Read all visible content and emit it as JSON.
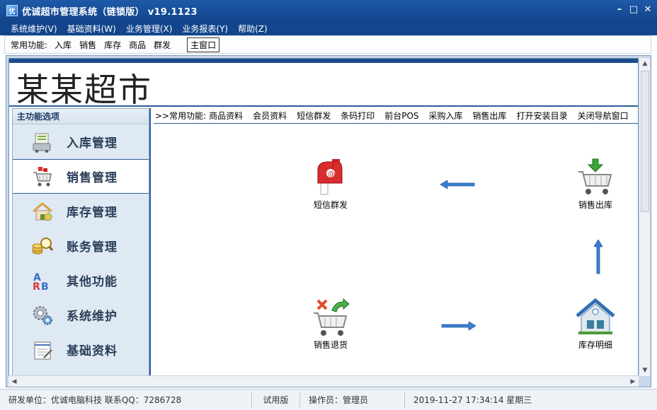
{
  "window": {
    "title": "优诚超市管理系统（链锁版） v19.1123",
    "app_icon_text": "优",
    "controls": {
      "minimize": "–",
      "maximize": "□",
      "close": "✕"
    }
  },
  "menubar": {
    "items": [
      {
        "label": "系统维护(V)"
      },
      {
        "label": "基础资料(W)"
      },
      {
        "label": "业务管理(X)"
      },
      {
        "label": "业务报表(Y)"
      },
      {
        "label": "帮助(Z)"
      }
    ]
  },
  "quickbar": {
    "label": "常用功能:",
    "items": [
      {
        "label": "入库"
      },
      {
        "label": "销售"
      },
      {
        "label": "库存"
      },
      {
        "label": "商品"
      },
      {
        "label": "群发"
      }
    ],
    "main_window_label": "主窗口"
  },
  "header": {
    "store_name": "某某超市"
  },
  "sidebar": {
    "title": "主功能选项",
    "items": [
      {
        "label": "入库管理",
        "icon": "stock-in-icon"
      },
      {
        "label": "销售管理",
        "icon": "sales-cart-icon",
        "active": true
      },
      {
        "label": "库存管理",
        "icon": "inventory-house-icon"
      },
      {
        "label": "账务管理",
        "icon": "coins-magnifier-icon"
      },
      {
        "label": "其他功能",
        "icon": "letters-icon"
      },
      {
        "label": "系统维护",
        "icon": "gears-icon"
      },
      {
        "label": "基础资料",
        "icon": "notepad-icon"
      }
    ]
  },
  "function_bar": {
    "label": ">>常用功能:",
    "items": [
      {
        "label": "商品资料"
      },
      {
        "label": "会员资料"
      },
      {
        "label": "短信群发"
      },
      {
        "label": "条码打印"
      },
      {
        "label": "前台POS"
      },
      {
        "label": "采购入库"
      },
      {
        "label": "销售出库"
      },
      {
        "label": "打开安装目录"
      },
      {
        "label": "关闭导航窗口"
      }
    ]
  },
  "flow": {
    "nodes": {
      "sms": {
        "label": "短信群发",
        "icon": "mailbox-icon"
      },
      "sales_out": {
        "label": "销售出库",
        "icon": "cart-down-arrow-icon"
      },
      "sales_return": {
        "label": "销售退货",
        "icon": "cart-return-icon"
      },
      "stock_detail": {
        "label": "库存明细",
        "icon": "warehouse-house-icon"
      }
    }
  },
  "statusbar": {
    "developer": "研发单位：优诚电脑科技    联系QQ：7286728",
    "edition": "试用版",
    "operator": "操作员：管理员",
    "datetime": "2019-11-27 17:34:14 星期三"
  },
  "colors": {
    "title_bar": "#1e5aa8",
    "accent_blue": "#2e5e9c",
    "sidebar_bg": "#dfe9f3",
    "arrow_blue": "#3a7fd0"
  }
}
